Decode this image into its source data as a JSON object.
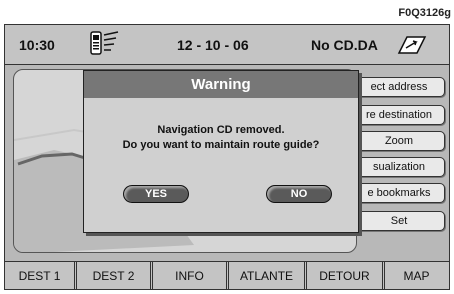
{
  "figure_id": "F0Q3126g",
  "status": {
    "time": "10:30",
    "date": "12 - 10 - 06",
    "cd_status": "No CD.DA",
    "phone_icon": "phone-signal-icon",
    "nav_icon": "navigation-arrow-icon"
  },
  "menu": {
    "items": [
      {
        "label": "ect address"
      },
      {
        "label": "re destination"
      },
      {
        "label": "Zoom"
      },
      {
        "label": "sualization"
      },
      {
        "label": "e bookmarks"
      },
      {
        "label": "Set"
      }
    ]
  },
  "dialog": {
    "title": "Warning",
    "message_line1": "Navigation CD removed.",
    "message_line2": "Do you want to maintain route guide?",
    "yes_label": "YES",
    "no_label": "NO"
  },
  "tabs": [
    "DEST 1",
    "DEST 2",
    "INFO",
    "ATLANTE",
    "DETOUR",
    "MAP"
  ]
}
